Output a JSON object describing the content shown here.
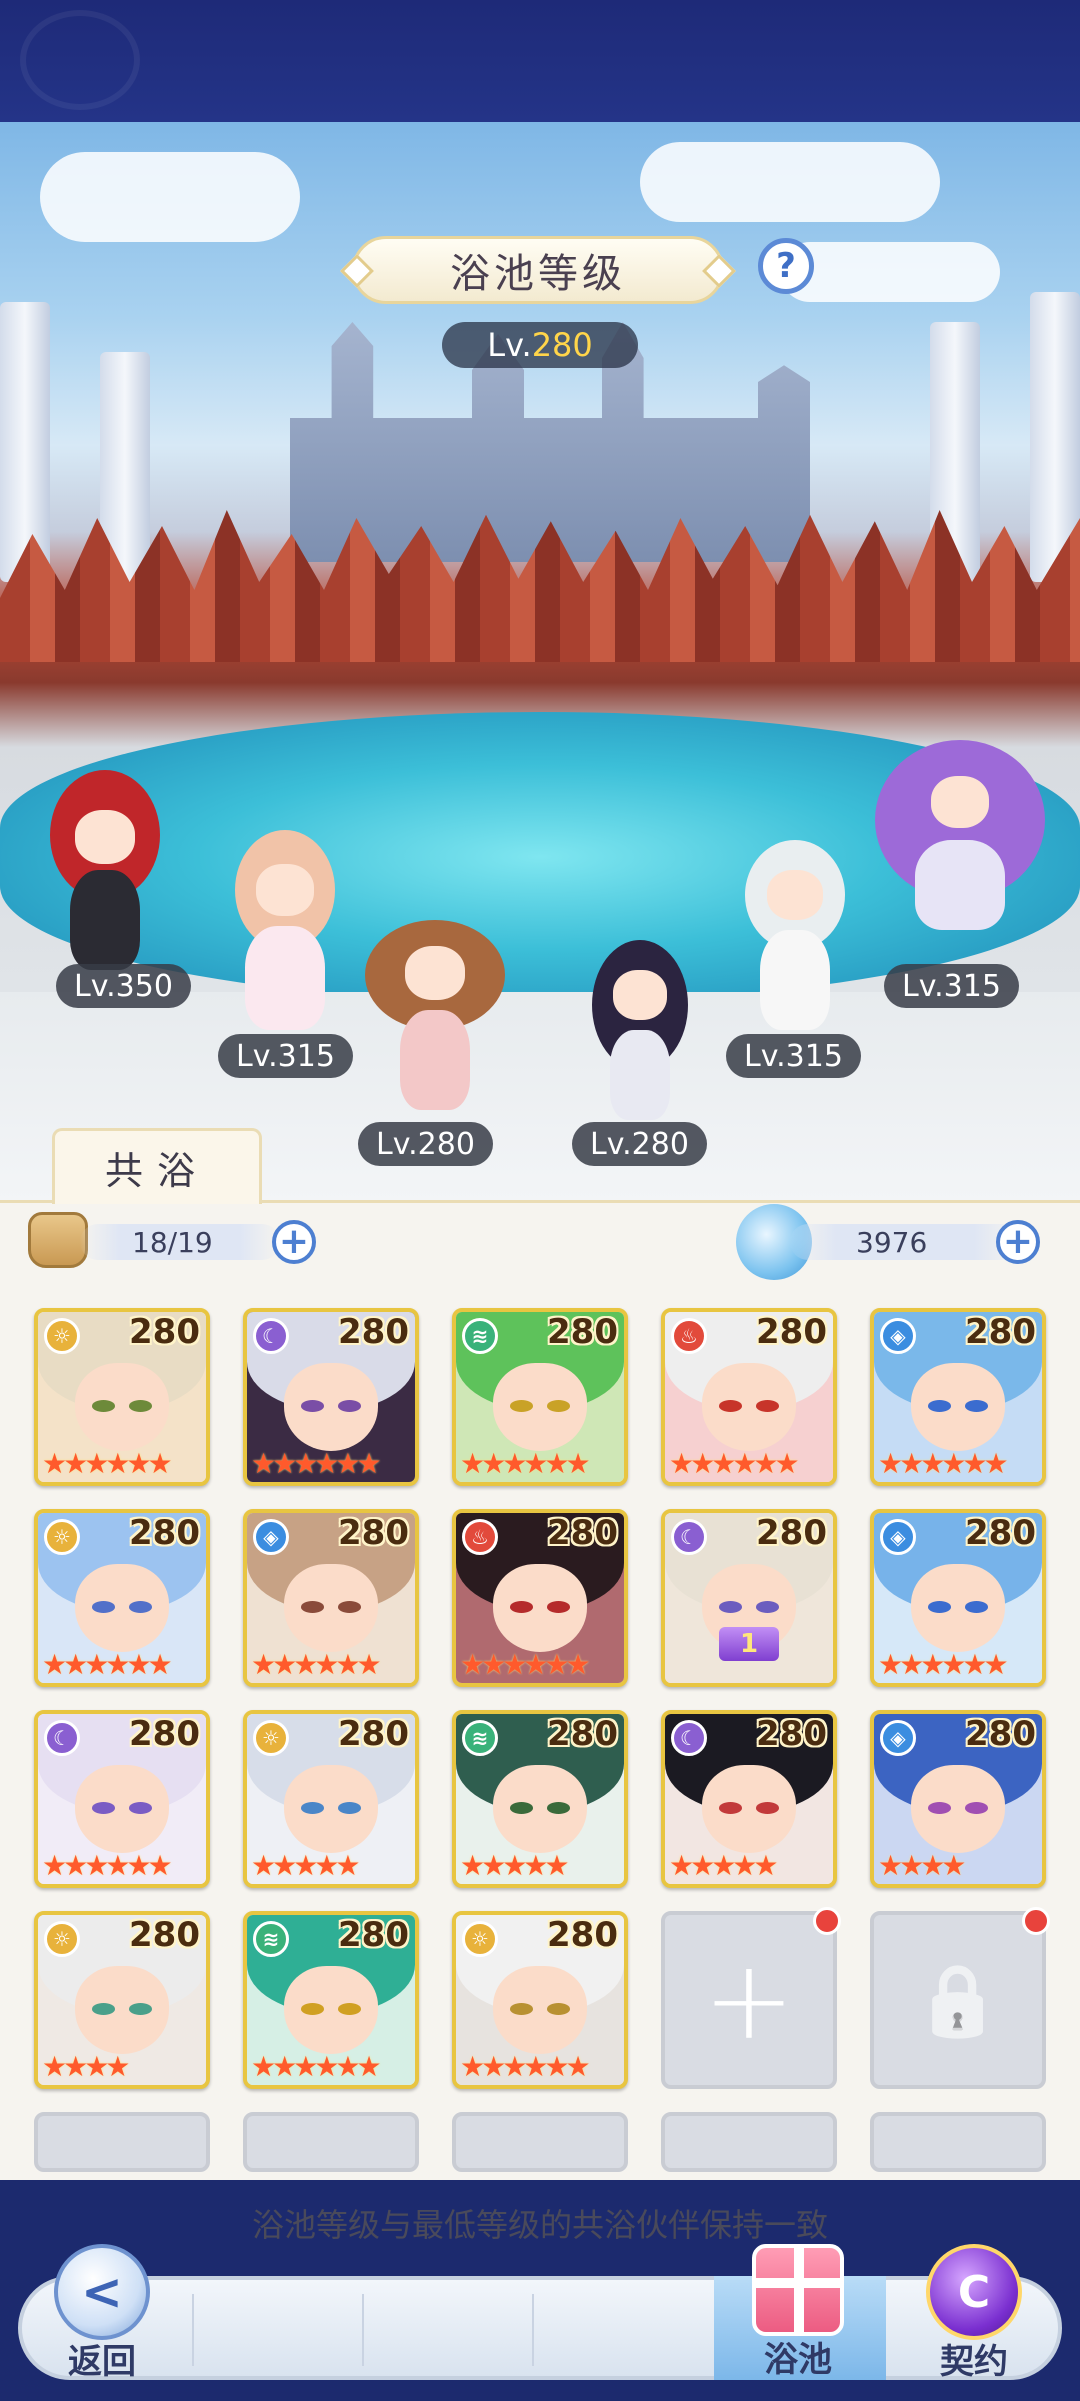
{
  "scene": {
    "title": "浴池等级",
    "help": "?",
    "level_prefix": "Lv.",
    "level_value": "280",
    "characters": [
      {
        "level": "Lv.350",
        "hair": "#c0262a"
      },
      {
        "level": "Lv.315",
        "hair": "#f1c3a8"
      },
      {
        "level": "Lv.280",
        "hair": "#a8683e"
      },
      {
        "level": "Lv.280",
        "hair": "#2b2440"
      },
      {
        "level": "Lv.315",
        "hair": "#e9eef0"
      },
      {
        "level": "Lv.315",
        "hair": "#9d6ad8"
      }
    ]
  },
  "tab": {
    "label": "共浴"
  },
  "stats": {
    "partners": "18/19",
    "plus": "+",
    "water": "3976"
  },
  "cards": [
    {
      "level": "280",
      "stars": "★★★★★★",
      "element": "sun",
      "elem_color": "#e8b23b",
      "elem_glyph": "☼",
      "hair": "#e8dcc4",
      "eye": "#6d8a3a",
      "bg": "#f4e2c8"
    },
    {
      "level": "280",
      "stars": "★★★★★★",
      "element": "moon",
      "elem_color": "#8a5fd1",
      "elem_glyph": "☾",
      "hair": "#d9dbe8",
      "eye": "#7a4ea6",
      "bg": "#3b2b44"
    },
    {
      "level": "280",
      "stars": "★★★★★★",
      "element": "wind",
      "elem_color": "#39b27a",
      "elem_glyph": "≋",
      "hair": "#5ec25b",
      "eye": "#c9a227",
      "bg": "#cfe7b6"
    },
    {
      "level": "280",
      "stars": "★★★★★★",
      "element": "fire",
      "elem_color": "#e24a3b",
      "elem_glyph": "♨",
      "hair": "#eeeeee",
      "eye": "#c7342a",
      "bg": "#f6d0d0"
    },
    {
      "level": "280",
      "stars": "★★★★★★",
      "element": "water",
      "elem_color": "#3b8de0",
      "elem_glyph": "◈",
      "hair": "#7ab8ea",
      "eye": "#3b6ccf",
      "bg": "#c5dcf5"
    },
    {
      "level": "280",
      "stars": "★★★★★★",
      "element": "sun",
      "elem_color": "#e8b23b",
      "elem_glyph": "☼",
      "hair": "#9cc3f0",
      "eye": "#5270c9",
      "bg": "#d9e6f7"
    },
    {
      "level": "280",
      "stars": "★★★★★★",
      "element": "water",
      "elem_color": "#3b8de0",
      "elem_glyph": "◈",
      "hair": "#c7a285",
      "eye": "#8a4b3a",
      "bg": "#efe1d2"
    },
    {
      "level": "280",
      "stars": "★★★★★★",
      "element": "fire",
      "elem_color": "#e24a3b",
      "elem_glyph": "♨",
      "hair": "#2a1b1f",
      "eye": "#b52b2b",
      "bg": "#b06a6f"
    },
    {
      "level": "280",
      "stars": "",
      "element": "moon",
      "elem_color": "#8a5fd1",
      "elem_glyph": "☾",
      "hair": "#e8e1d4",
      "eye": "#6b5dbf",
      "bg": "#efe6da",
      "badge": "1"
    },
    {
      "level": "280",
      "stars": "★★★★★★",
      "element": "water",
      "elem_color": "#3b8de0",
      "elem_glyph": "◈",
      "hair": "#77b3ea",
      "eye": "#3b6ccf",
      "bg": "#d6e8f8"
    },
    {
      "level": "280",
      "stars": "★★★★★★",
      "element": "moon",
      "elem_color": "#8a5fd1",
      "elem_glyph": "☾",
      "hair": "#e6dff2",
      "eye": "#7a5cc4",
      "bg": "#f1ecf7"
    },
    {
      "level": "280",
      "stars": "★★★★★",
      "element": "sun",
      "elem_color": "#e8b23b",
      "elem_glyph": "☼",
      "hair": "#d7dde9",
      "eye": "#4a86c8",
      "bg": "#eef0f5"
    },
    {
      "level": "280",
      "stars": "★★★★★",
      "element": "wind",
      "elem_color": "#39b27a",
      "elem_glyph": "≋",
      "hair": "#2f5e4f",
      "eye": "#3a6a3a",
      "bg": "#e9f1ec"
    },
    {
      "level": "280",
      "stars": "★★★★★",
      "element": "moon",
      "elem_color": "#8a5fd1",
      "elem_glyph": "☾",
      "hair": "#1b1a22",
      "eye": "#c23a3a",
      "bg": "#f2e6e2"
    },
    {
      "level": "280",
      "stars": "★★★★",
      "element": "water",
      "elem_color": "#3b8de0",
      "elem_glyph": "◈",
      "hair": "#3c64c2",
      "eye": "#a04fb2",
      "bg": "#cbd7f2"
    },
    {
      "level": "280",
      "stars": "★★★★",
      "element": "sun",
      "elem_color": "#e8b23b",
      "elem_glyph": "☼",
      "hair": "#ececec",
      "eye": "#4aa08a",
      "bg": "#efe9e4"
    },
    {
      "level": "280",
      "stars": "★★★★★★",
      "element": "wind",
      "elem_color": "#39b27a",
      "elem_glyph": "≋",
      "hair": "#2faf95",
      "eye": "#d0a022",
      "bg": "#d6efe5"
    },
    {
      "level": "280",
      "stars": "★★★★★★",
      "element": "sun",
      "elem_color": "#e8b23b",
      "elem_glyph": "☼",
      "hair": "#f1f1f1",
      "eye": "#b89132",
      "bg": "#e7e3df"
    }
  ],
  "slots": [
    {
      "type": "add",
      "glyph": "+"
    },
    {
      "type": "locked",
      "glyph": "🔒"
    }
  ],
  "note": "浴池等级与最低等级的共浴伙伴保持一致",
  "nav": {
    "back": "返回",
    "back_glyph": "<",
    "bath": "浴池",
    "contract": "契约",
    "contract_glyph": "C"
  }
}
